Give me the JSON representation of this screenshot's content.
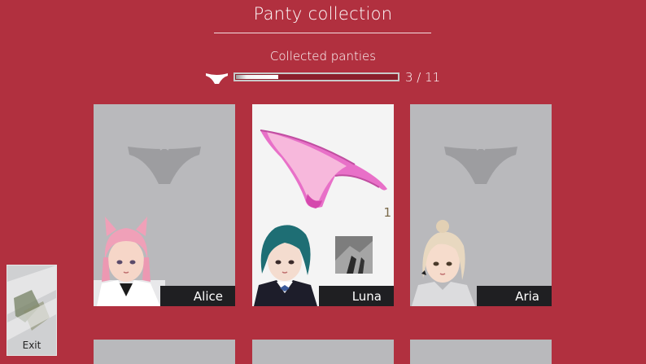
{
  "header": {
    "title": "Panty collection",
    "subtitle": "Collected panties"
  },
  "progress": {
    "collected": 3,
    "total": 11,
    "text": "3 / 11",
    "fraction": 0.27
  },
  "cards": [
    {
      "name": "Alice",
      "unlocked": false,
      "hair_color": "#f0a0b8"
    },
    {
      "name": "Luna",
      "unlocked": true,
      "count": "1",
      "hair_color": "#1e6e74",
      "panty_color": "#e870c8"
    },
    {
      "name": "Aria",
      "unlocked": false,
      "hair_color": "#e8d8c0"
    }
  ],
  "exit": {
    "label": "Exit"
  },
  "colors": {
    "background": "#b1303f",
    "card_locked": "#b9b9bc",
    "name_bar": "#1f1f22"
  }
}
